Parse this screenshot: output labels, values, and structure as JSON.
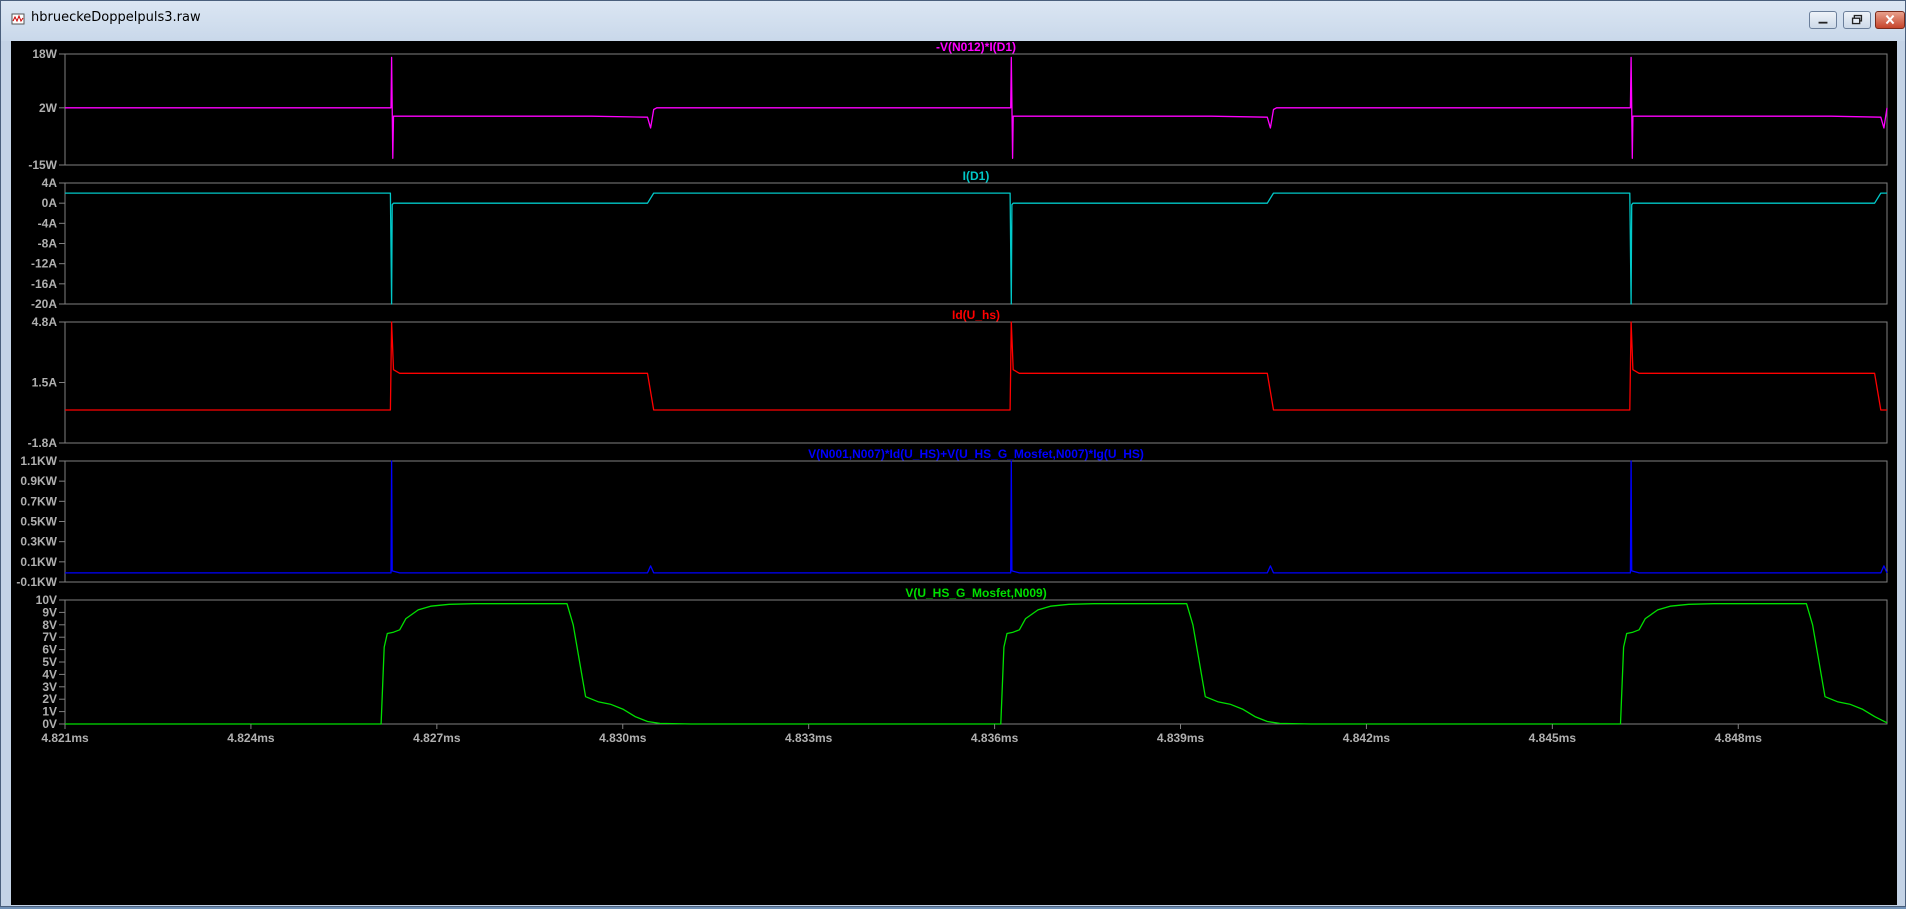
{
  "window": {
    "title": "hbrueckeDoppelpuls3.raw"
  },
  "colors": {
    "pane1": "#ff00ff",
    "pane2": "#00c8c8",
    "pane3": "#ff0000",
    "pane4": "#0000ff",
    "pane5": "#00e000",
    "grid": "#808080",
    "axis_text": "#b0b0b0"
  },
  "chart_data": {
    "type": "line",
    "x_axis": {
      "unit": "ms",
      "range": [
        4.821,
        4.8504
      ],
      "ticks": [
        4.821,
        4.824,
        4.827,
        4.83,
        4.833,
        4.836,
        4.839,
        4.842,
        4.845,
        4.848
      ],
      "tick_labels": [
        "4.821ms",
        "4.824ms",
        "4.827ms",
        "4.830ms",
        "4.833ms",
        "4.836ms",
        "4.839ms",
        "4.842ms",
        "4.845ms",
        "4.848ms"
      ]
    },
    "panes": [
      {
        "title": "-V(N012)*I(D1)",
        "unit": "W",
        "ylim": [
          -15,
          18
        ],
        "ticks": [
          18,
          2,
          -15
        ],
        "tick_labels": [
          "18W",
          "2W",
          "-15W"
        ],
        "series": [
          {
            "x": [
              4.821,
              4.82626,
              4.82627,
              4.82629,
              4.8263,
              4.8264,
              4.8295,
              4.8304,
              4.83045,
              4.8305,
              4.83055,
              4.8306,
              4.8361,
              4.83626,
              4.83627,
              4.83629,
              4.8363,
              4.8364,
              4.8395,
              4.8404,
              4.84045,
              4.8405,
              4.84055,
              4.8406,
              4.8461,
              4.84626,
              4.84627,
              4.84629,
              4.8463,
              4.8464,
              4.8495,
              4.8503,
              4.85035,
              4.8504
            ],
            "y": [
              2,
              2,
              17,
              -13,
              -0.5,
              -0.5,
              -0.5,
              -0.8,
              -4,
              1.5,
              2,
              2,
              2,
              2,
              17,
              -13,
              -0.5,
              -0.5,
              -0.5,
              -0.8,
              -4,
              1.5,
              2,
              2,
              2,
              2,
              17,
              -13,
              -0.5,
              -0.5,
              -0.5,
              -0.8,
              -4,
              2
            ]
          }
        ]
      },
      {
        "title": "I(D1)",
        "unit": "A",
        "ylim": [
          -20,
          4
        ],
        "ticks": [
          4,
          0,
          -4,
          -8,
          -12,
          -16,
          -20
        ],
        "tick_labels": [
          "4A",
          "0A",
          "-4A",
          "-8A",
          "-12A",
          "-16A",
          "-20A"
        ],
        "series": [
          {
            "x": [
              4.821,
              4.82625,
              4.82627,
              4.82628,
              4.8263,
              4.8304,
              4.8305,
              4.8361,
              4.83625,
              4.83627,
              4.83628,
              4.8363,
              4.8404,
              4.8405,
              4.8461,
              4.84625,
              4.84627,
              4.84628,
              4.8463,
              4.8502,
              4.8503,
              4.8504
            ],
            "y": [
              2,
              2,
              -20,
              -0.3,
              0,
              0,
              2,
              2,
              2,
              -20,
              -0.3,
              0,
              0,
              2,
              2,
              2,
              -20,
              -0.3,
              0,
              0,
              2,
              2
            ]
          }
        ]
      },
      {
        "title": "Id(U_hs)",
        "unit": "A",
        "ylim": [
          -1.8,
          4.8
        ],
        "ticks": [
          4.8,
          1.5,
          -1.8
        ],
        "tick_labels": [
          "4.8A",
          "1.5A",
          "-1.8A"
        ],
        "series": [
          {
            "x": [
              4.821,
              4.82625,
              4.82627,
              4.8263,
              4.8264,
              4.8304,
              4.8305,
              4.8361,
              4.83625,
              4.83627,
              4.8363,
              4.8364,
              4.8404,
              4.8405,
              4.8461,
              4.84625,
              4.84627,
              4.8463,
              4.8464,
              4.8502,
              4.8503,
              4.8504
            ],
            "y": [
              0,
              0,
              4.8,
              2.2,
              2.0,
              2.0,
              0,
              0,
              0,
              4.8,
              2.2,
              2.0,
              2.0,
              0,
              0,
              0,
              4.8,
              2.2,
              2.0,
              2.0,
              0,
              0
            ]
          }
        ]
      },
      {
        "title": "V(N001,N007)*Id(U_HS)+V(U_HS_G_Mosfet,N007)*Ig(U_HS)",
        "unit": "KW",
        "ylim": [
          -0.1,
          1.1
        ],
        "ticks": [
          1.1,
          0.9,
          0.7,
          0.5,
          0.3,
          0.1,
          -0.1
        ],
        "tick_labels": [
          "1.1KW",
          "0.9KW",
          "0.7KW",
          "0.5KW",
          "0.3KW",
          "0.1KW",
          "-0.1KW"
        ],
        "series": [
          {
            "x": [
              4.821,
              4.82626,
              4.82627,
              4.82628,
              4.8264,
              4.8304,
              4.83045,
              4.8305,
              4.8361,
              4.83626,
              4.83627,
              4.83628,
              4.8364,
              4.8404,
              4.84045,
              4.8405,
              4.8461,
              4.84626,
              4.84627,
              4.84628,
              4.8464,
              4.8503,
              4.85035,
              4.8504
            ],
            "y": [
              -0.01,
              -0.01,
              1.1,
              0.01,
              -0.01,
              -0.01,
              0.06,
              -0.01,
              -0.01,
              -0.01,
              1.1,
              0.01,
              -0.01,
              -0.01,
              0.06,
              -0.01,
              -0.01,
              -0.01,
              1.1,
              0.01,
              -0.01,
              -0.01,
              0.06,
              -0.01
            ]
          }
        ]
      },
      {
        "title": "V(U_HS_G_Mosfet,N009)",
        "unit": "V",
        "ylim": [
          0,
          10
        ],
        "ticks": [
          10,
          9,
          8,
          7,
          6,
          5,
          4,
          3,
          2,
          1,
          0
        ],
        "tick_labels": [
          "10V",
          "9V",
          "8V",
          "7V",
          "6V",
          "5V",
          "4V",
          "3V",
          "2V",
          "1V",
          "0V"
        ],
        "series": [
          {
            "x": [
              4.821,
              4.8261,
              4.82615,
              4.8262,
              4.8263,
              4.8264,
              4.8265,
              4.8267,
              4.8269,
              4.8272,
              4.8276,
              4.828,
              4.8291,
              4.8292,
              4.8294,
              4.8296,
              4.8298,
              4.83,
              4.8302,
              4.8304,
              4.8306,
              4.8311,
              4.8361,
              4.83615,
              4.8362,
              4.8363,
              4.8364,
              4.8365,
              4.8367,
              4.8369,
              4.8372,
              4.8376,
              4.838,
              4.8391,
              4.8392,
              4.8394,
              4.8396,
              4.8398,
              4.84,
              4.8402,
              4.8404,
              4.8406,
              4.8411,
              4.8461,
              4.84615,
              4.8462,
              4.8463,
              4.8464,
              4.8465,
              4.8467,
              4.8469,
              4.8472,
              4.8476,
              4.848,
              4.8491,
              4.8492,
              4.8494,
              4.8496,
              4.8498,
              4.85,
              4.8502,
              4.8504
            ],
            "y": [
              0,
              0,
              6.2,
              7.3,
              7.4,
              7.6,
              8.5,
              9.2,
              9.5,
              9.65,
              9.7,
              9.7,
              9.7,
              8.0,
              2.2,
              1.8,
              1.6,
              1.2,
              0.6,
              0.2,
              0.05,
              0,
              0,
              6.2,
              7.3,
              7.4,
              7.6,
              8.5,
              9.2,
              9.5,
              9.65,
              9.7,
              9.7,
              9.7,
              8.0,
              2.2,
              1.8,
              1.6,
              1.2,
              0.6,
              0.2,
              0.05,
              0,
              0,
              6.2,
              7.3,
              7.4,
              7.6,
              8.5,
              9.2,
              9.5,
              9.65,
              9.7,
              9.7,
              9.7,
              8.0,
              2.2,
              1.8,
              1.6,
              1.2,
              0.6,
              0.1
            ]
          }
        ]
      }
    ]
  }
}
